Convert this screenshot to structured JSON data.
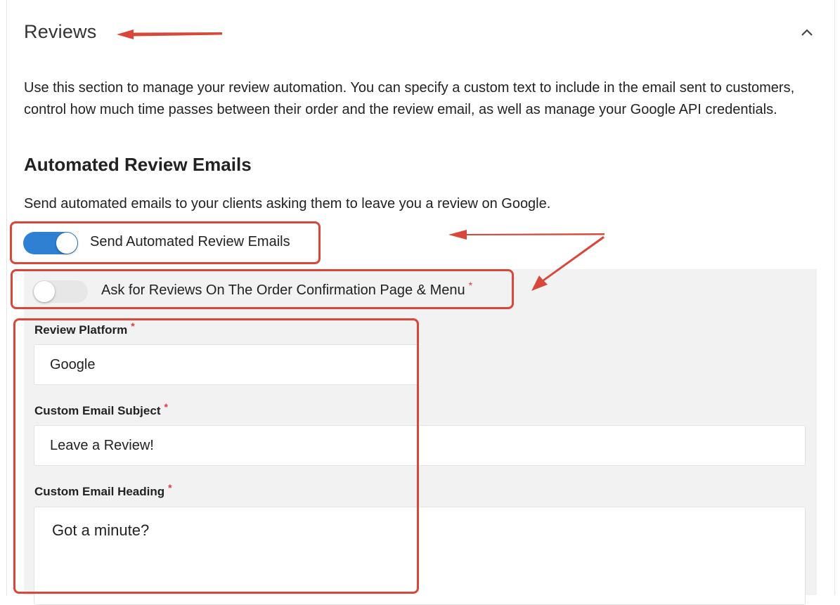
{
  "section": {
    "title": "Reviews",
    "description": "Use this section to manage your review automation. You can specify a custom text to include in the email sent to customers, control how much time passes between their order and the review email, as well as manage your Google API credentials."
  },
  "automated": {
    "heading": "Automated Review Emails",
    "subtitle": "Send automated emails to your clients asking them to leave you a review on Google."
  },
  "toggles": {
    "send_emails": {
      "label": "Send Automated Review Emails",
      "state": "on"
    },
    "ask_reviews": {
      "label": "Ask for Reviews On The Order Confirmation Page & Menu",
      "required_mark": "*",
      "state": "off"
    }
  },
  "fields": {
    "review_platform": {
      "label": "Review Platform",
      "required_mark": "*",
      "value": "Google"
    },
    "email_subject": {
      "label": "Custom Email Subject",
      "required_mark": "*",
      "value": "Leave a Review!"
    },
    "email_heading": {
      "label": "Custom Email Heading",
      "required_mark": "*",
      "value": "Got a minute?"
    }
  },
  "colors": {
    "accent": "#2f7fd3",
    "annotation": "#d9473a",
    "required": "#e03b3b",
    "panel_bg": "#f2f2f2"
  },
  "icons": {
    "collapse": "chevron-up-icon"
  }
}
